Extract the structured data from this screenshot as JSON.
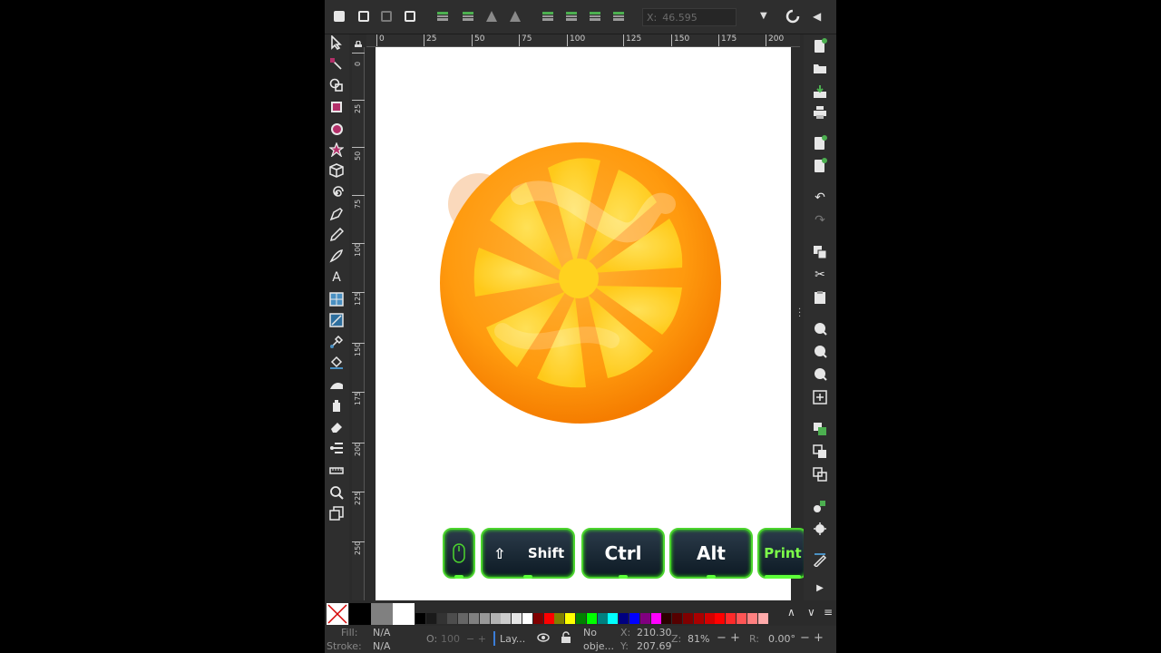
{
  "toolbar": {
    "x_label": "X:",
    "x_value": "46.595"
  },
  "toolbox": {
    "icons": [
      "selector-icon",
      "node-icon",
      "shape-builder-icon",
      "rectangle-icon",
      "circle-icon",
      "star-icon",
      "3d-box-icon",
      "spiral-icon",
      "pen-icon",
      "pencil-icon",
      "calligraphy-icon",
      "text-icon",
      "mesh-icon",
      "gradient-icon",
      "dropper-icon",
      "paint-bucket-icon",
      "tweak-icon",
      "spray-icon",
      "eraser-icon",
      "connector-icon",
      "measure-icon",
      "zoom-icon",
      "pages-icon"
    ],
    "text_tool_glyph": "A"
  },
  "ruler_top": {
    "labels": [
      "0",
      "25",
      "50",
      "75",
      "100",
      "125",
      "150",
      "175",
      "200"
    ]
  },
  "ruler_left": {
    "labels": [
      "0",
      "25",
      "50",
      "75",
      "100",
      "125",
      "150",
      "175",
      "200",
      "225",
      "250"
    ]
  },
  "keys": {
    "shift": "Shift",
    "ctrl": "Ctrl",
    "alt": "Alt",
    "print": "Print",
    "shift_glyph": "⇧"
  },
  "commands": {
    "icons": [
      "new-document-icon",
      "open-icon",
      "save-icon",
      "print-icon",
      "import-icon",
      "export-icon",
      "undo-icon",
      "redo-icon",
      "copy-icon",
      "cut-icon",
      "paste-icon",
      "zoom-selection-icon",
      "zoom-drawing-icon",
      "zoom-page-icon",
      "zoom-fit-icon",
      "duplicate-icon",
      "clone-icon",
      "unlink-clone-icon",
      "group-icon",
      "ungroup-icon",
      "fill-stroke-icon",
      "expand-icon"
    ]
  },
  "palette": {
    "colors": [
      "#000000",
      "#1a1a1a",
      "#333333",
      "#4d4d4d",
      "#666666",
      "#808080",
      "#999999",
      "#b3b3b3",
      "#cccccc",
      "#e6e6e6",
      "#ffffff",
      "#800000",
      "#ff0000",
      "#808000",
      "#ffff00",
      "#008000",
      "#00ff00",
      "#008080",
      "#00ffff",
      "#000080",
      "#0000ff",
      "#800080",
      "#ff00ff",
      "#2b0000",
      "#550000",
      "#800000",
      "#aa0000",
      "#d40000",
      "#ff0000",
      "#ff2a2a",
      "#ff5555",
      "#ff8080",
      "#ffaaaa"
    ]
  },
  "status": {
    "fill_label": "Fill:",
    "fill_value": "N/A",
    "stroke_label": "Stroke:",
    "stroke_value": "N/A",
    "opacity_label": "O:",
    "opacity_value": "100",
    "layer_label": "Lay...",
    "object_line1": "No",
    "object_line2": "obje...",
    "x_label": "X:",
    "x_value": "210.30",
    "y_label": "Y:",
    "y_value": "207.69",
    "zoom_label": "Z:",
    "zoom_value": "81%",
    "rotate_label": "R:",
    "rotate_value": "0.00°"
  }
}
